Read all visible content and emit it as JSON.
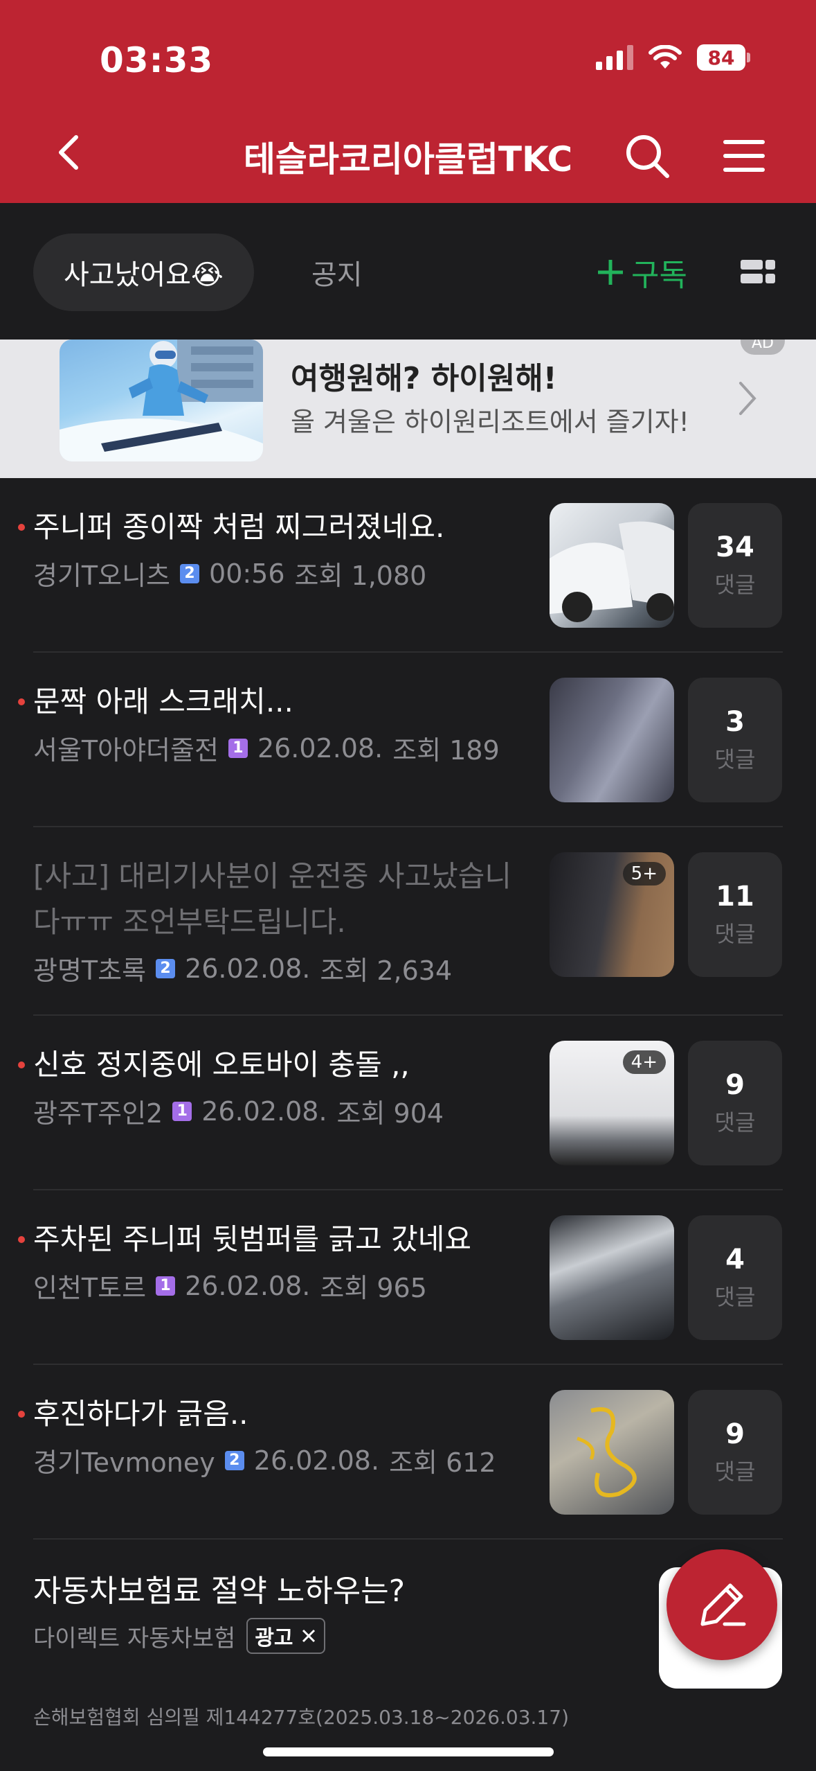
{
  "status_bar": {
    "time": "03:33",
    "battery": "84"
  },
  "header": {
    "title": "테슬라코리아클럽TKC"
  },
  "tabs": {
    "active": "사고났어요😭",
    "notice": "공지",
    "subscribe": "구독"
  },
  "ad_banner": {
    "title": "여행원해? 하이원해!",
    "subtitle": "올 겨울은 하이원리조트에서 즐기자!",
    "badge": "AD"
  },
  "posts": [
    {
      "title": "주니퍼 종이짝 처럼 찌그러졌네요.",
      "author": "경기T오니츠",
      "level": "2",
      "time": "00:56",
      "views": "조회 1,080",
      "comments": "34",
      "comment_label": "댓글",
      "more": "",
      "read": false
    },
    {
      "title": "문짝 아래 스크래치...",
      "author": "서울T아야더줄전",
      "level": "1",
      "time": "26.02.08.",
      "views": "조회 189",
      "comments": "3",
      "comment_label": "댓글",
      "more": "",
      "read": false
    },
    {
      "title": "[사고] 대리기사분이 운전중 사고났습니다ㅠㅠ 조언부탁드립니다.",
      "author": "광명T초록",
      "level": "2",
      "time": "26.02.08.",
      "views": "조회 2,634",
      "comments": "11",
      "comment_label": "댓글",
      "more": "5+",
      "read": true
    },
    {
      "title": "신호 정지중에 오토바이 충돌 ,,",
      "author": "광주T주인2",
      "level": "1",
      "time": "26.02.08.",
      "views": "조회 904",
      "comments": "9",
      "comment_label": "댓글",
      "more": "4+",
      "read": false
    },
    {
      "title": "주차된 주니퍼 뒷범퍼를 긁고 갔네요",
      "author": "인천T토르",
      "level": "1",
      "time": "26.02.08.",
      "views": "조회 965",
      "comments": "4",
      "comment_label": "댓글",
      "more": "",
      "read": false
    },
    {
      "title": "후진하다가 긁음..",
      "author": "경기Tevmoney",
      "level": "2",
      "time": "26.02.08.",
      "views": "조회 612",
      "comments": "9",
      "comment_label": "댓글",
      "more": "",
      "read": false
    }
  ],
  "ad_post": {
    "title": "자동차보험료 절약 노하우는?",
    "source": "다이렉트 자동차보험",
    "tag": "광고",
    "disclaimer": "손해보험협회 심의필 제144277호(2025.03.18~2026.03.17)"
  },
  "colors": {
    "brand": "#bd2432",
    "background": "#1c1c1e",
    "subscribe": "#22b35b",
    "new_dot": "#e5423d"
  }
}
